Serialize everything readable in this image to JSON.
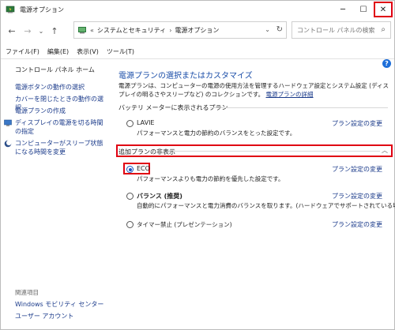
{
  "window": {
    "title": "電源オプション",
    "caption": {
      "minimize": "─",
      "maximize": "☐",
      "close": "✕"
    }
  },
  "nav": {
    "back": "←",
    "forward": "→",
    "recent": "⌄",
    "up": "↑",
    "breadcrumb_prefix": "«",
    "crumbs": [
      "システムとセキュリティ",
      "電源オプション"
    ],
    "crumb_sep": "›",
    "dropdown": "⌄",
    "refresh": "↻",
    "search_placeholder": "コントロール パネルの検索",
    "search_glyph": "⌕"
  },
  "menubar": {
    "items": [
      "ファイル(F)",
      "編集(E)",
      "表示(V)",
      "ツール(T)"
    ]
  },
  "left": {
    "home": "コントロール パネル ホーム",
    "links": [
      "電源ボタンの動作の選択",
      "カバーを閉じたときの動作の選択",
      "電源プランの作成",
      "ディスプレイの電源を切る時間の指定",
      "コンピューターがスリープ状態になる時間を変更"
    ],
    "related_label": "関連項目",
    "related_links": [
      "Windows モビリティ センター",
      "ユーザー アカウント"
    ]
  },
  "main": {
    "help": "?",
    "title": "電源プランの選択またはカスタマイズ",
    "description": "電源プランは、コンピューターの電源の使用方法を管理するハードウェア設定とシステム設定 (ディスプレイの明るさやスリープなど) のコレクションです。",
    "description_link": "電源プランの詳細",
    "battery_section": "バッテリ メーターに表示されるプラン",
    "hidden_section": "追加プランの非表示",
    "collapse_glyph": "︿",
    "plans": [
      {
        "name": "LAVIE",
        "desc": "パフォーマンスと電力の節約のバランスをとった設定です。",
        "link": "プラン設定の変更",
        "selected": false
      },
      {
        "name": "ECO",
        "desc": "パフォーマンスよりも電力の節約を優先した設定です。",
        "link": "プラン設定の変更",
        "selected": true
      },
      {
        "name": "バランス (推奨)",
        "desc": "自動的にパフォーマンスと電力消費のバランスを取ります。(ハードウェアでサポートされている場合)",
        "link": "プラン設定の変更",
        "selected": false
      },
      {
        "name": "タイマー禁止 (プレゼンテーション)",
        "desc": "",
        "link": "プラン設定の変更",
        "selected": false
      }
    ]
  },
  "colors": {
    "highlight": "#e00012",
    "link": "#1a3a8a",
    "title": "#1a4da8"
  }
}
